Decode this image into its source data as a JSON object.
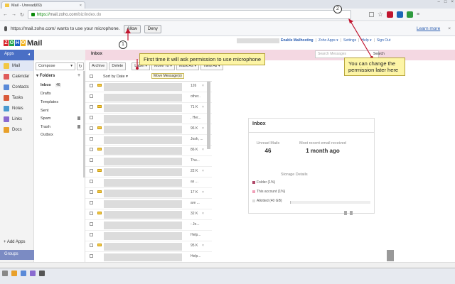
{
  "browser": {
    "tab_title": "Mail - Unread(69)",
    "url_scheme": "https://",
    "url_host": "mail.zoho.com",
    "url_path": "/biz/index.do"
  },
  "mic_prompt": {
    "message": "https://mail.zoho.com/ wants to use your microphone.",
    "allow_label": "Allow",
    "deny_label": "Deny",
    "learn_more": "Learn more"
  },
  "header": {
    "logo_letters": [
      "Z",
      "O",
      "H",
      "O"
    ],
    "logo_suffix": "Mail",
    "links": [
      "Enable Mailhosting",
      "|",
      "Zoho Apps ▾",
      "|",
      "Settings",
      "|",
      "Help ▾",
      "|",
      "Sign Out"
    ],
    "search_placeholder": "Search Messages",
    "search_label": "Search"
  },
  "apps": {
    "label": "Apps",
    "items": [
      "Mail",
      "Calendar",
      "Contacts",
      "Tasks",
      "Notes",
      "Links",
      "Docs"
    ],
    "add_apps": "+ Add Apps",
    "groups": "Groups"
  },
  "folders": {
    "compose": "Compose",
    "header": "Folders",
    "items": [
      "Inbox",
      "Drafts",
      "Templates",
      "Sent",
      "Spam",
      "Trash",
      "Outbox"
    ],
    "inbox_count": "46"
  },
  "main": {
    "inbox_title": "Inbox",
    "toolbar": [
      "Archive",
      "Delete",
      "Label ▾",
      "Move To ▾",
      "Mark As ▾",
      "View All ▾"
    ],
    "tooltip": "Move Message(s)",
    "sort_label": "Sort by Date ▾",
    "row_numbers": [
      "126",
      "other..",
      "71 K",
      ", Her...",
      "96 K",
      "Josh, ...",
      "86 K",
      "Thu...",
      "22 K",
      "as ...",
      "17 K",
      "are ...",
      "32 K",
      "- Jo...",
      "Help...",
      "95 K",
      "Help...",
      "21 K"
    ]
  },
  "info_panel": {
    "title": "Inbox",
    "unread_label": "Unread Mails",
    "unread_value": "46",
    "recent_label": "Most recent email received",
    "recent_value": "1 month ago",
    "storage_label": "Storage Details",
    "legend": [
      "Folder  (1%)",
      "This account  (1%)",
      "Allotted  (40 GB)"
    ],
    "storage_fraction": 0.01
  },
  "annotations": {
    "one": "1",
    "one_text": "First time it will ask permission to use microphone",
    "two": "2",
    "two_text": "You can change the permission later here"
  },
  "colors": {
    "accent": "#4a6fc5",
    "inbox_bar": "#f4d8e2",
    "callout": "#fdf5a6",
    "arrow": "#c0152f"
  }
}
